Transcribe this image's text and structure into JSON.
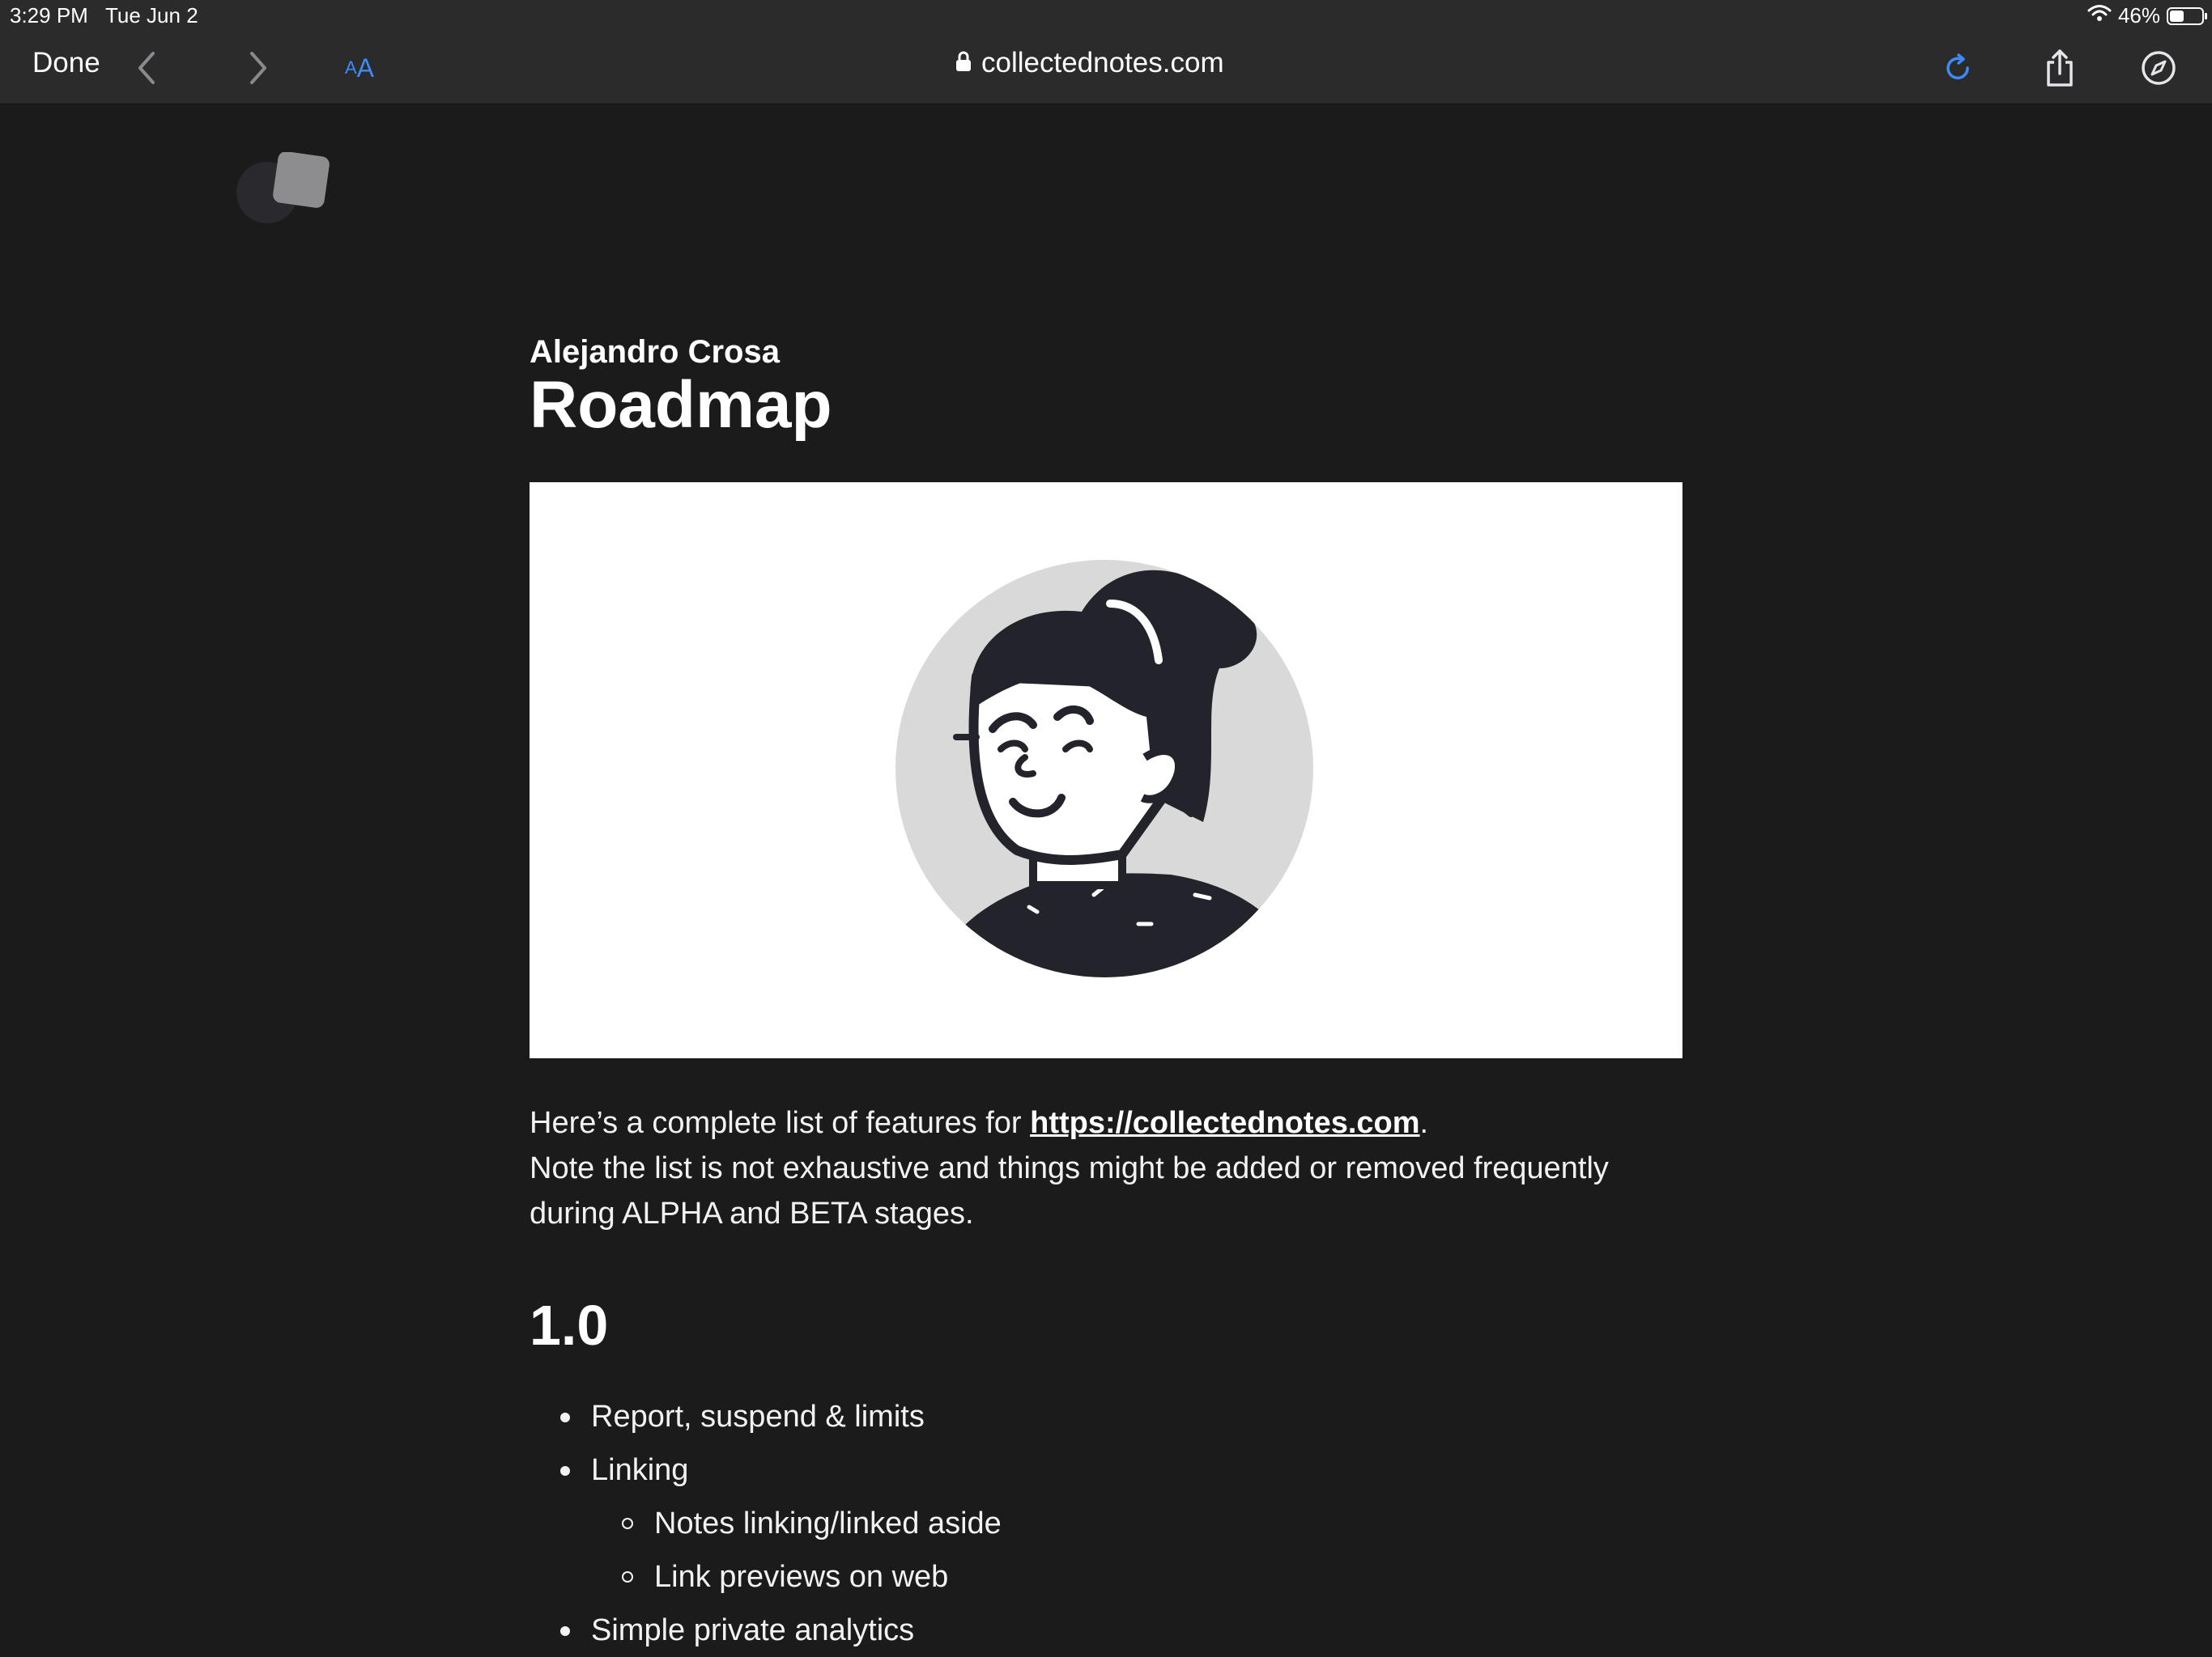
{
  "status_bar": {
    "time": "3:29 PM",
    "date": "Tue Jun 2",
    "battery_percent": "46%",
    "battery_level": 0.46
  },
  "browser": {
    "done_label": "Done",
    "text_size_label_small": "A",
    "text_size_label_large": "A",
    "url": "collectednotes.com",
    "accent_color": "#3e8af7",
    "icons": [
      "back-chevron-icon",
      "forward-chevron-icon",
      "lock-icon",
      "reload-icon",
      "share-icon",
      "compass-icon"
    ]
  },
  "page": {
    "author": "Alejandro Crosa",
    "title": "Roadmap",
    "intro_before_link": "Here’s a complete list of features for ",
    "intro_link": "https://collectednotes.com",
    "intro_after_link": ".",
    "intro_line2": "Note the list is not exhaustive and things might be added or removed frequently during ALPHA and BETA stages.",
    "section_title": "1.0",
    "features": [
      {
        "label": "Report, suspend & limits",
        "level": 1
      },
      {
        "label": "Linking",
        "level": 1
      },
      {
        "label": "Notes linking/linked aside",
        "level": 2
      },
      {
        "label": "Link previews on web",
        "level": 2
      },
      {
        "label": "Simple private analytics",
        "level": 1
      }
    ]
  }
}
